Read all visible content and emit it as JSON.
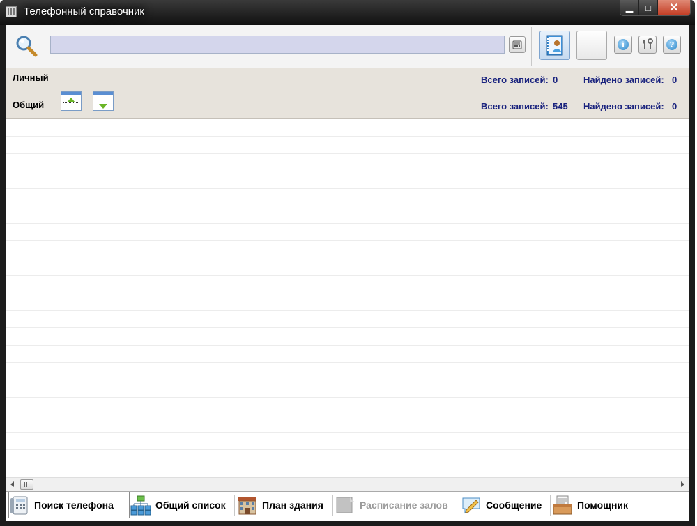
{
  "window": {
    "title": "Телефонный справочник",
    "controls": {
      "minimize": "▁",
      "maximize": "□",
      "close": "✕"
    }
  },
  "toolbar": {
    "search": {
      "value": "",
      "placeholder": ""
    },
    "icons": {
      "search": "magnifier-icon",
      "clear": "calculator-icon",
      "contacts": "address-book-icon",
      "info": "info-icon",
      "settings": "tools-icon",
      "help": "help-icon"
    },
    "info_glyph": "i",
    "help_glyph": "?"
  },
  "groups": {
    "personal": {
      "label": "Личный",
      "total_label": "Всего записей:",
      "total": "0",
      "found_label": "Найдено записей:",
      "found": "0"
    },
    "common": {
      "label": "Общий",
      "total_label": "Всего записей:",
      "total": "545",
      "found_label": "Найдено записей:",
      "found": "0"
    }
  },
  "tabs": [
    {
      "label": "Поиск телефона",
      "icon": "phone-icon",
      "active": true,
      "enabled": true
    },
    {
      "label": "Общий список",
      "icon": "org-chart-icon",
      "active": false,
      "enabled": true
    },
    {
      "label": "План здания",
      "icon": "building-icon",
      "active": false,
      "enabled": true
    },
    {
      "label": "Расписание залов",
      "icon": "schedule-icon",
      "active": false,
      "enabled": false
    },
    {
      "label": "Сообщение",
      "icon": "message-icon",
      "active": false,
      "enabled": true
    },
    {
      "label": "Помощник",
      "icon": "assistant-icon",
      "active": false,
      "enabled": true
    }
  ],
  "colors": {
    "count_text": "#1a237e",
    "group_bg": "#e7e3dc",
    "search_bg": "#d4d6ec",
    "disabled_text": "#9a9a9a"
  }
}
